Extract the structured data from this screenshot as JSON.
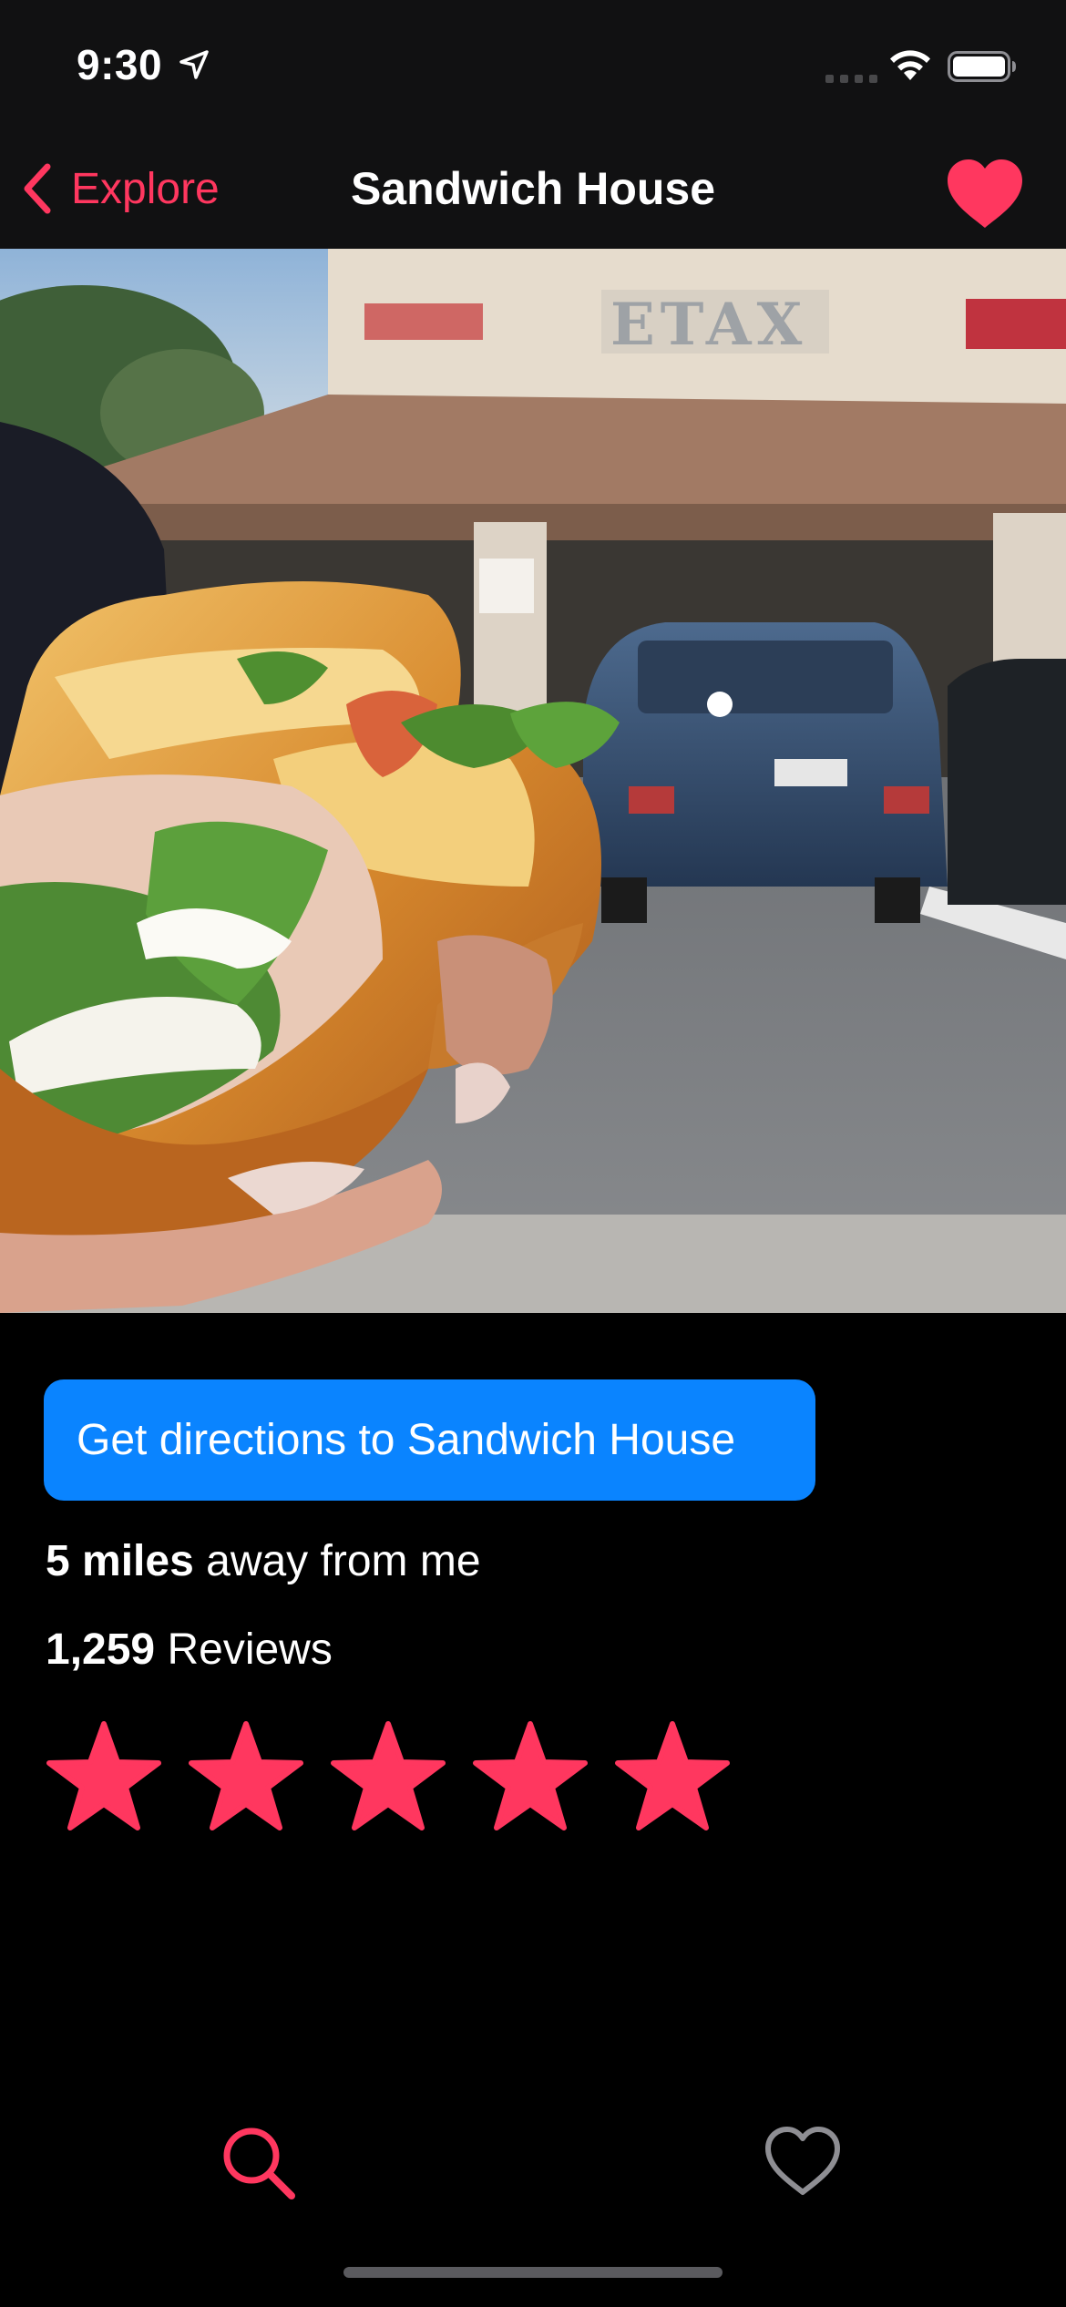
{
  "status_bar": {
    "time": "9:30",
    "icons": [
      "location-arrow-icon",
      "cellular-signal-icon",
      "wifi-icon",
      "battery-icon"
    ]
  },
  "nav": {
    "back_label": "Explore",
    "title": "Sandwich House",
    "back_icon": "chevron-left-icon",
    "favorite_icon": "heart-filled-icon",
    "favorited": true
  },
  "hero": {
    "description_icon": "sandwich-photo"
  },
  "details": {
    "directions_label": "Get directions to Sandwich House",
    "distance_value": "5 miles",
    "distance_suffix": " away from me",
    "reviews_count": "1,259",
    "reviews_suffix": " Reviews",
    "rating": 5,
    "rating_max": 5
  },
  "tab_bar": {
    "items": [
      {
        "icon": "search-icon",
        "active": true
      },
      {
        "icon": "heart-outline-icon",
        "active": false
      }
    ]
  },
  "colors": {
    "accent": "#ff375f",
    "button_blue": "#0a84ff",
    "bar_background": "#111112",
    "background": "#000000",
    "inactive_icon": "#8e8e93"
  }
}
